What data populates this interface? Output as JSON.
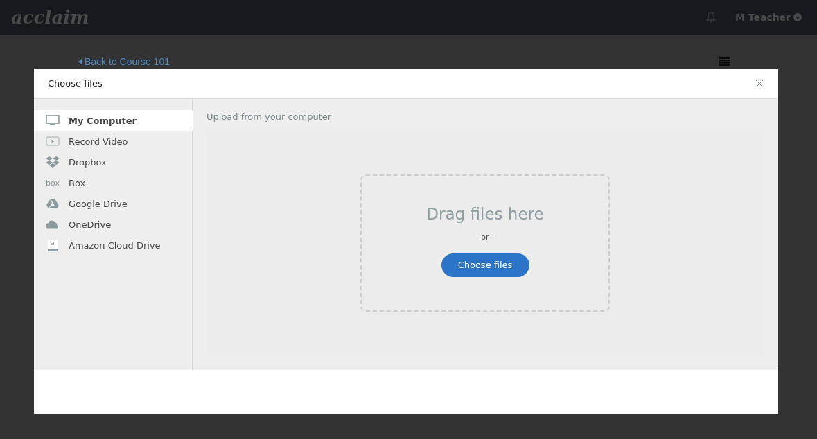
{
  "topbar": {
    "logo": "acclaim",
    "user": "M Teacher"
  },
  "page": {
    "back_link": "Back to Course 101"
  },
  "dialog": {
    "title": "Choose files",
    "sources": [
      {
        "kind": "computer",
        "label": "My Computer",
        "selected": true
      },
      {
        "kind": "video",
        "label": "Record Video",
        "selected": false
      },
      {
        "kind": "dropbox",
        "label": "Dropbox",
        "selected": false
      },
      {
        "kind": "box",
        "label": "Box",
        "icon_text": "box",
        "selected": false
      },
      {
        "kind": "gdrive",
        "label": "Google Drive",
        "selected": false
      },
      {
        "kind": "onedrive",
        "label": "OneDrive",
        "selected": false
      },
      {
        "kind": "amazon",
        "label": "Amazon Cloud Drive",
        "icon_text": "a",
        "selected": false
      }
    ],
    "panel_title": "Upload from your computer",
    "drop_text": "Drag files here",
    "or_text": "- or -",
    "choose_button": "Choose files"
  }
}
